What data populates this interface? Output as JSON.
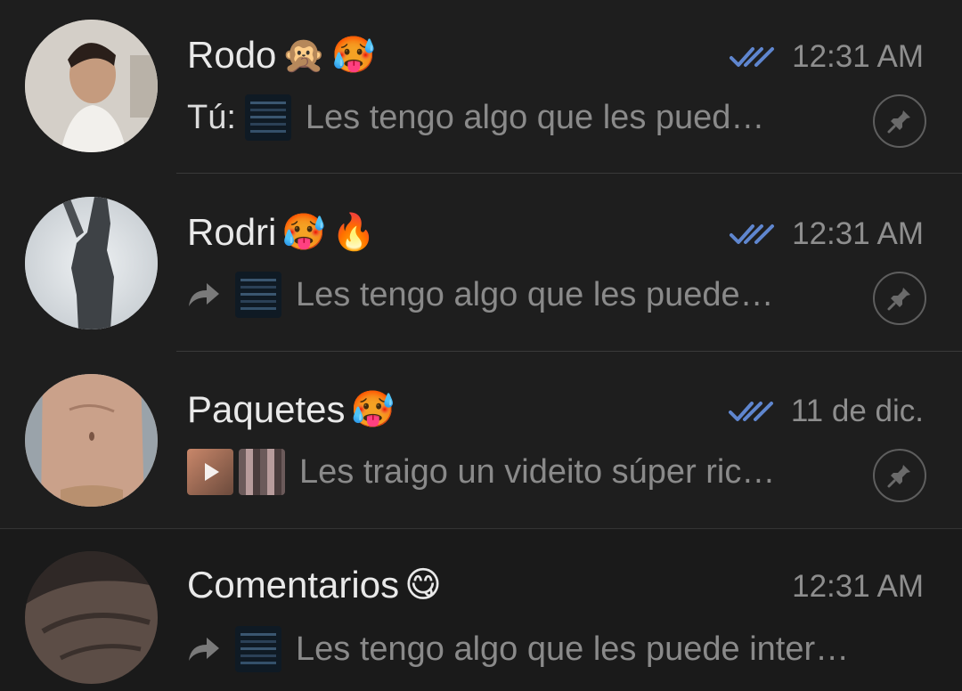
{
  "chats": [
    {
      "name": "Rodo",
      "emojis": [
        "🙊",
        "🥵"
      ],
      "time": "12:31 AM",
      "read": true,
      "prefix": "Tú:",
      "preview": "Les tengo algo que les pued…",
      "pinned": true,
      "avatar_icon": "person-photo"
    },
    {
      "name": "Rodri",
      "emojis": [
        "🥵",
        "🔥"
      ],
      "time": "12:31 AM",
      "read": true,
      "forwarded": true,
      "preview": "Les tengo algo que les puede…",
      "pinned": true,
      "avatar_icon": "silhouette-photo"
    },
    {
      "name": "Paquetes",
      "emojis": [
        "🥵"
      ],
      "time": "11 de dic.",
      "read": true,
      "preview": "Les traigo un videito súper ric…",
      "pinned": true,
      "avatar_icon": "torso-photo"
    },
    {
      "name": "Comentarios",
      "emojis": [
        "😋"
      ],
      "time": "12:31 AM",
      "read": false,
      "forwarded": true,
      "preview": "Les tengo algo que les puede inter…",
      "pinned": false,
      "avatar_icon": "torso-photo"
    }
  ],
  "colors": {
    "background": "#1e1e1e",
    "read_check": "#5f86cf",
    "name": "#e9e9e9",
    "muted": "#8e8e8e"
  }
}
